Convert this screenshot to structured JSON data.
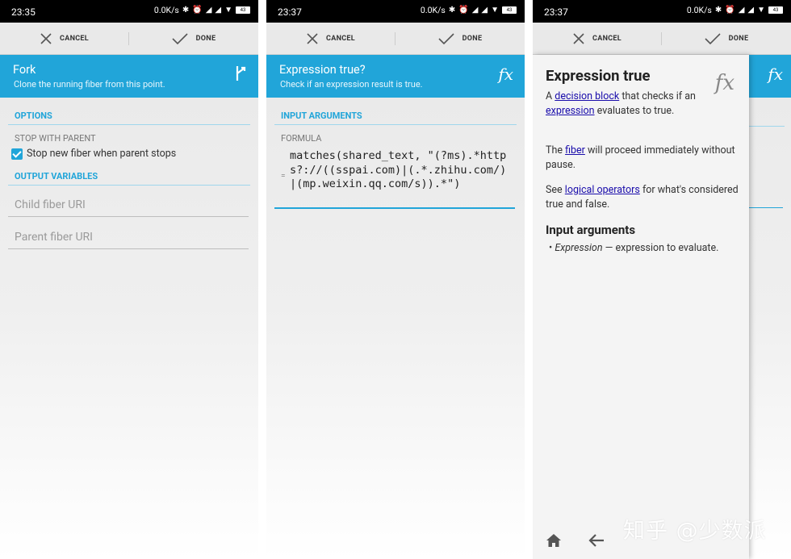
{
  "status": {
    "p1_time": "23:35",
    "p2_time": "23:37",
    "p3_time": "23:37",
    "speed": "0.0K/s",
    "battery": "43"
  },
  "actions": {
    "cancel": "CANCEL",
    "done": "DONE"
  },
  "fork": {
    "title": "Fork",
    "subtitle": "Clone the running fiber from this point.",
    "options_header": "OPTIONS",
    "stop_label": "STOP WITH PARENT",
    "stop_checkbox": "Stop new fiber when parent stops",
    "output_header": "OUTPUT VARIABLES",
    "child_placeholder": "Child fiber URI",
    "parent_placeholder": "Parent fiber URI"
  },
  "expression": {
    "title": "Expression true?",
    "subtitle": "Check if an expression result is true.",
    "input_header": "INPUT ARGUMENTS",
    "formula_label": "FORMULA",
    "formula": "matches(shared_text, \"(?ms).*https?://((sspai.com)|(.*.zhihu.com/)|(mp.weixin.qq.com/s)).*\")"
  },
  "help": {
    "title": "Expression true",
    "p1_a": "A ",
    "p1_link1": "decision block",
    "p1_b": " that checks if an ",
    "p1_link2": "expression",
    "p1_c": " evaluates to true.",
    "p2_a": "The ",
    "p2_link": "fiber",
    "p2_b": " will proceed immediately without pause.",
    "p3_a": "See ",
    "p3_link": "logical operators",
    "p3_b": " for what's considered true and false.",
    "input_args": "Input arguments",
    "bullet_name": "Expression",
    "bullet_desc": " — expression to evaluate."
  },
  "watermark": "知乎 @少数派",
  "colors": {
    "accent": "#21a5d9",
    "link": "#1a0dab"
  }
}
